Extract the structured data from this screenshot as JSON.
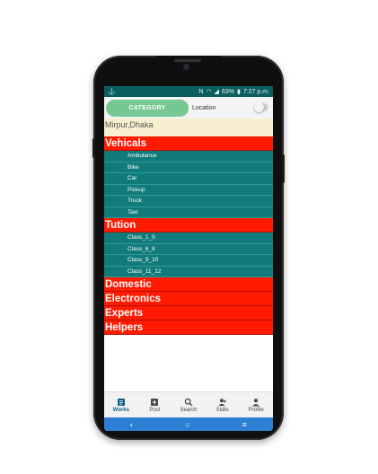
{
  "status_bar": {
    "left_icon": "android-debug-icon",
    "battery": "63%",
    "time": "7:27 p.m."
  },
  "topbar": {
    "category_label": "CATEGORY",
    "location_label": "Location"
  },
  "location_text": "Mirpur,Dhaka",
  "categories": [
    {
      "title": "Vehicals",
      "items": [
        "Ambulance",
        "Bike",
        "Car",
        "Pickup",
        "Truck",
        "Taxi"
      ]
    },
    {
      "title": "Tution",
      "items": [
        "Class_1_5",
        "Class_6_8",
        "Class_9_10",
        "Class_11_12"
      ]
    },
    {
      "title": "Domestic",
      "items": []
    },
    {
      "title": "Electronics",
      "items": []
    },
    {
      "title": "Experts",
      "items": []
    },
    {
      "title": "Helpers",
      "items": []
    }
  ],
  "bottom_nav": [
    {
      "label": "Works",
      "icon": "works-icon",
      "active": true
    },
    {
      "label": "Post",
      "icon": "post-icon",
      "active": false
    },
    {
      "label": "Search",
      "icon": "search-icon",
      "active": false
    },
    {
      "label": "Skills",
      "icon": "skills-icon",
      "active": false
    },
    {
      "label": "Profile",
      "icon": "profile-icon",
      "active": false
    }
  ],
  "colors": {
    "header_red": "#ff1a00",
    "sub_teal": "#117a7a",
    "status_teal": "#0b5e5e",
    "category_green": "#76c893",
    "sysnav_blue": "#2d7fd3"
  }
}
